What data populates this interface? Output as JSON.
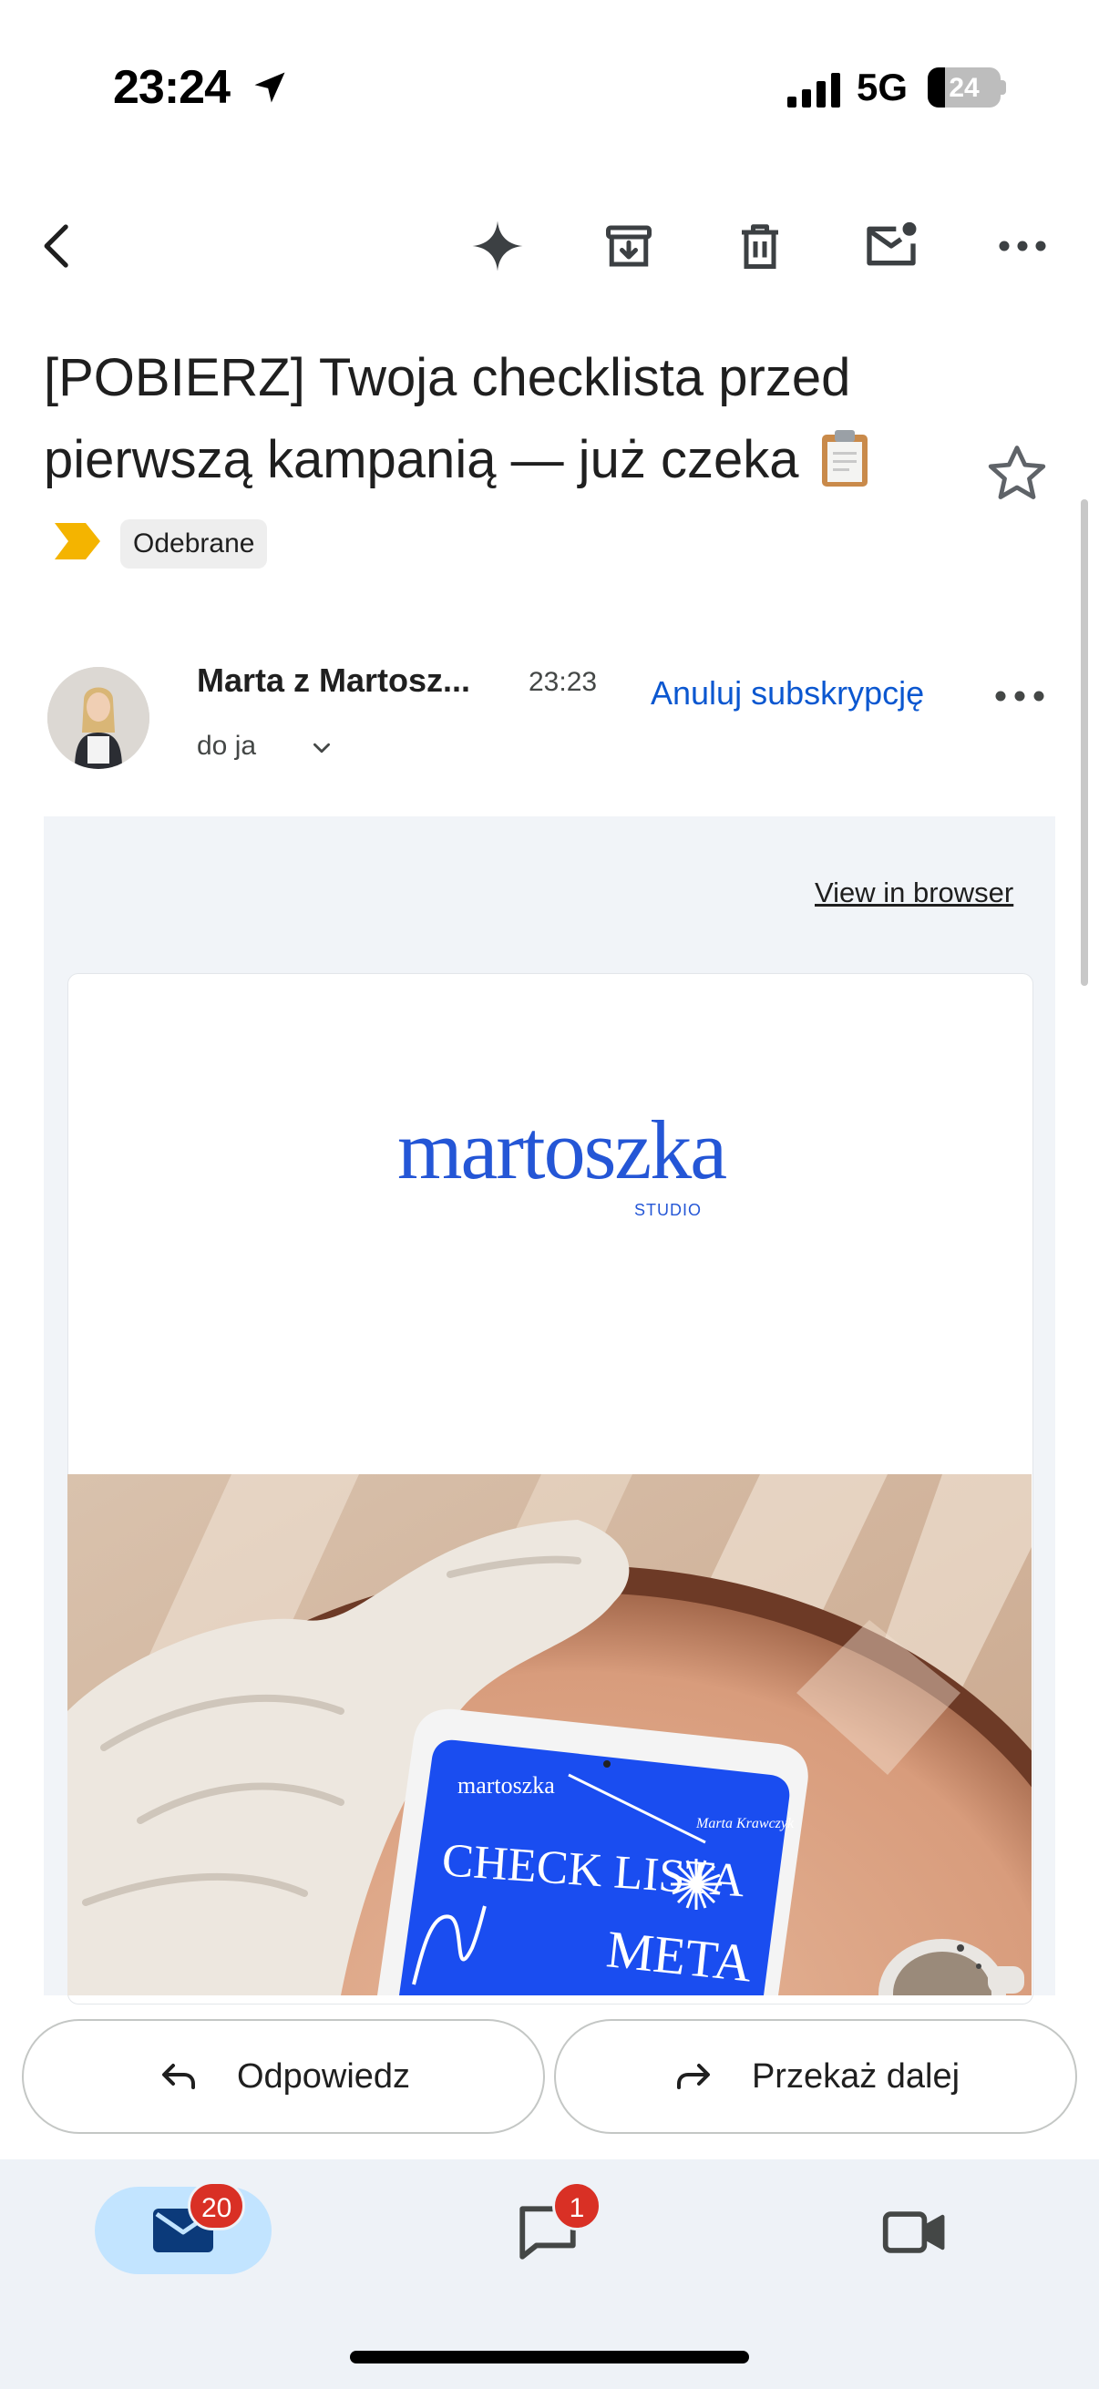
{
  "status_bar": {
    "time": "23:24",
    "network": "5G",
    "battery": "24"
  },
  "email": {
    "subject": "[POBIERZ] Twoja checklista przed pierwszą kampanią — już czeka",
    "label": "Odebrane",
    "sender": "Marta z Martosz...",
    "time": "23:23",
    "to": "do ja",
    "unsubscribe": "Anuluj subskrypcję"
  },
  "body": {
    "view_in_browser": "View in browser",
    "logo_text": "martoszka",
    "logo_sub": "STUDIO",
    "tablet": {
      "brand": "martoszka",
      "author": "Marta Krawczyk",
      "title": "CHECK LISTA",
      "subtitle": "META"
    }
  },
  "actions": {
    "reply": "Odpowiedz",
    "forward": "Przekaż dalej"
  },
  "nav": {
    "mail_badge": "20",
    "chat_badge": "1"
  },
  "icons": {
    "back": "back-arrow-icon",
    "sparkle": "gemini-sparkle-icon",
    "archive": "archive-icon",
    "delete": "trash-icon",
    "unread": "mark-unread-icon",
    "more": "more-horizontal-icon",
    "star": "star-icon",
    "mail": "mail-icon",
    "chat": "chat-icon",
    "meet": "video-icon"
  },
  "colors": {
    "accent": "#0b57d0",
    "brand_blue": "#2456d6",
    "badge_red": "#d93025",
    "nav_bg": "#eef2f7",
    "label_yellow": "#f4b400"
  }
}
